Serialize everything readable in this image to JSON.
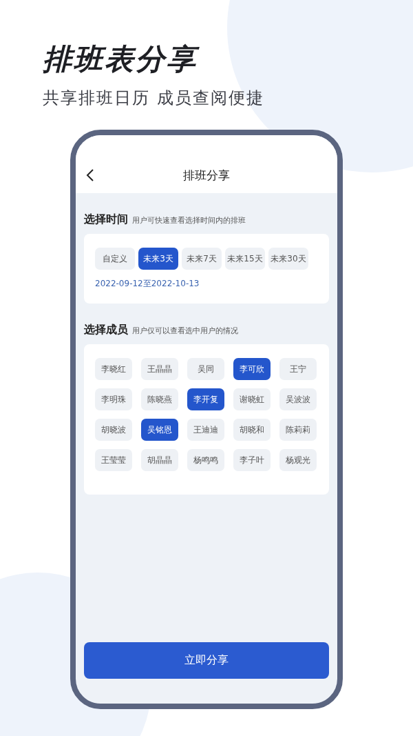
{
  "headline": "排班表分享",
  "subtitle": "共享排班日历 成员查阅便捷",
  "screen": {
    "title": "排班分享",
    "time_section": {
      "title": "选择时间",
      "hint": "用户可快速查看选择时间内的排班",
      "options": [
        {
          "label": "自定义",
          "selected": false
        },
        {
          "label": "未来3天",
          "selected": true
        },
        {
          "label": "未来7天",
          "selected": false
        },
        {
          "label": "未来15天",
          "selected": false
        },
        {
          "label": "未来30天",
          "selected": false
        }
      ],
      "range": "2022-09-12至2022-10-13"
    },
    "member_section": {
      "title": "选择成员",
      "hint": "用户仅可以查看选中用户的情况",
      "members": [
        {
          "name": "李晓红",
          "selected": false
        },
        {
          "name": "王晶晶",
          "selected": false
        },
        {
          "name": "吴同",
          "selected": false
        },
        {
          "name": "李可欣",
          "selected": true
        },
        {
          "name": "王宁",
          "selected": false
        },
        {
          "name": "李明珠",
          "selected": false
        },
        {
          "name": "陈晓燕",
          "selected": false
        },
        {
          "name": "李开复",
          "selected": true
        },
        {
          "name": "谢晓虹",
          "selected": false
        },
        {
          "name": "吴波波",
          "selected": false
        },
        {
          "name": "胡晓波",
          "selected": false
        },
        {
          "name": "吴铭恩",
          "selected": true
        },
        {
          "name": "王迪迪",
          "selected": false
        },
        {
          "name": "胡晓和",
          "selected": false
        },
        {
          "name": "陈莉莉",
          "selected": false
        },
        {
          "name": "王莹莹",
          "selected": false
        },
        {
          "name": "胡晶晶",
          "selected": false
        },
        {
          "name": "杨鸣鸣",
          "selected": false
        },
        {
          "name": "李子叶",
          "selected": false
        },
        {
          "name": "杨观光",
          "selected": false
        }
      ]
    },
    "share_button": "立即分享"
  }
}
